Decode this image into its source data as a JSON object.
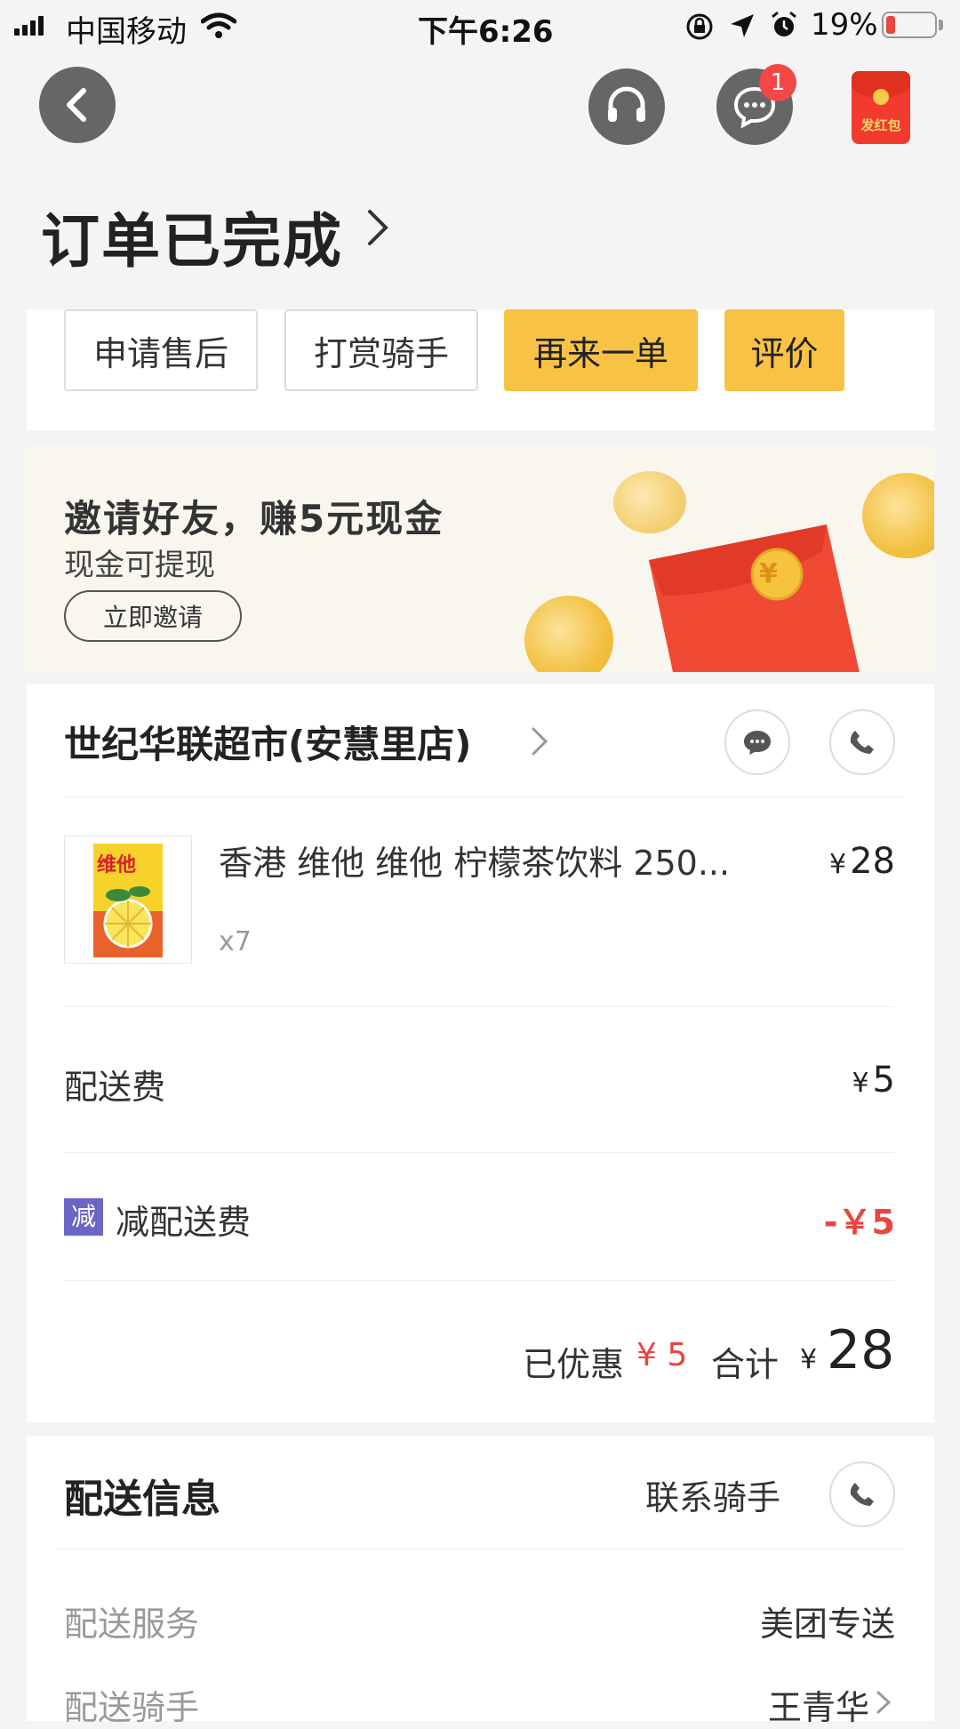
{
  "status_bar": {
    "carrier": "中国移动",
    "time": "下午6:26",
    "battery_text": "19%",
    "battery_level": 0.19
  },
  "header": {
    "message_badge_count": "1",
    "red_packet_label": "发红包",
    "title": "订单已完成"
  },
  "actions": [
    {
      "label": "申请售后"
    },
    {
      "label": "打赏骑手"
    },
    {
      "label": "再来一单"
    },
    {
      "label": "评价"
    }
  ],
  "banner": {
    "title": "邀请好友，赚5元现金",
    "subtitle": "现金可提现",
    "button": "立即邀请",
    "coin_symbol": "¥"
  },
  "store": {
    "name": "世纪华联超市(安慧里店)",
    "product": {
      "name": "香港 维他 维他 柠檬茶饮料 250...",
      "quantity": "x7",
      "price": "28",
      "box_text": "维他"
    },
    "currency": "¥",
    "delivery_fee_label": "配送费",
    "delivery_fee": "5",
    "discount_tag": "减",
    "discount_label": "减配送费",
    "discount_value": "-￥5",
    "saved_label": "已优惠",
    "saved_value": "¥ 5",
    "total_label": "合计",
    "total_value": "28"
  },
  "delivery": {
    "title": "配送信息",
    "contact_rider": "联系骑手",
    "service_label": "配送服务",
    "service_value": "美团专送",
    "rider_label": "配送骑手",
    "rider_value": "王青华"
  },
  "colors": {
    "accent": "#f8c245",
    "discount_red": "#e8463f",
    "tag_purple": "#6b66c4"
  }
}
